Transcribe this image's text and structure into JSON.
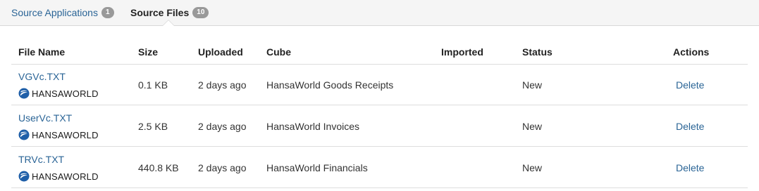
{
  "tabs": [
    {
      "label": "Source Applications",
      "count": "1"
    },
    {
      "label": "Source Files",
      "count": "10"
    }
  ],
  "table": {
    "headers": {
      "file_name": "File Name",
      "size": "Size",
      "uploaded": "Uploaded",
      "cube": "Cube",
      "imported": "Imported",
      "status": "Status",
      "actions": "Actions"
    },
    "rows": [
      {
        "file_name": "VGVc.TXT",
        "source": "HANSAWORLD",
        "size": "0.1 KB",
        "uploaded": "2 days ago",
        "cube": "HansaWorld Goods Receipts",
        "imported": "",
        "status": "New",
        "action": "Delete"
      },
      {
        "file_name": "UserVc.TXT",
        "source": "HANSAWORLD",
        "size": "2.5 KB",
        "uploaded": "2 days ago",
        "cube": "HansaWorld Invoices",
        "imported": "",
        "status": "New",
        "action": "Delete"
      },
      {
        "file_name": "TRVc.TXT",
        "source": "HANSAWORLD",
        "size": "440.8 KB",
        "uploaded": "2 days ago",
        "cube": "HansaWorld Financials",
        "imported": "",
        "status": "New",
        "action": "Delete"
      }
    ]
  },
  "colors": {
    "link": "#2a6496",
    "badge": "#999999",
    "logo_blue": "#1f5fa8"
  },
  "icons": {
    "logo": "hansaworld-logo-icon"
  }
}
